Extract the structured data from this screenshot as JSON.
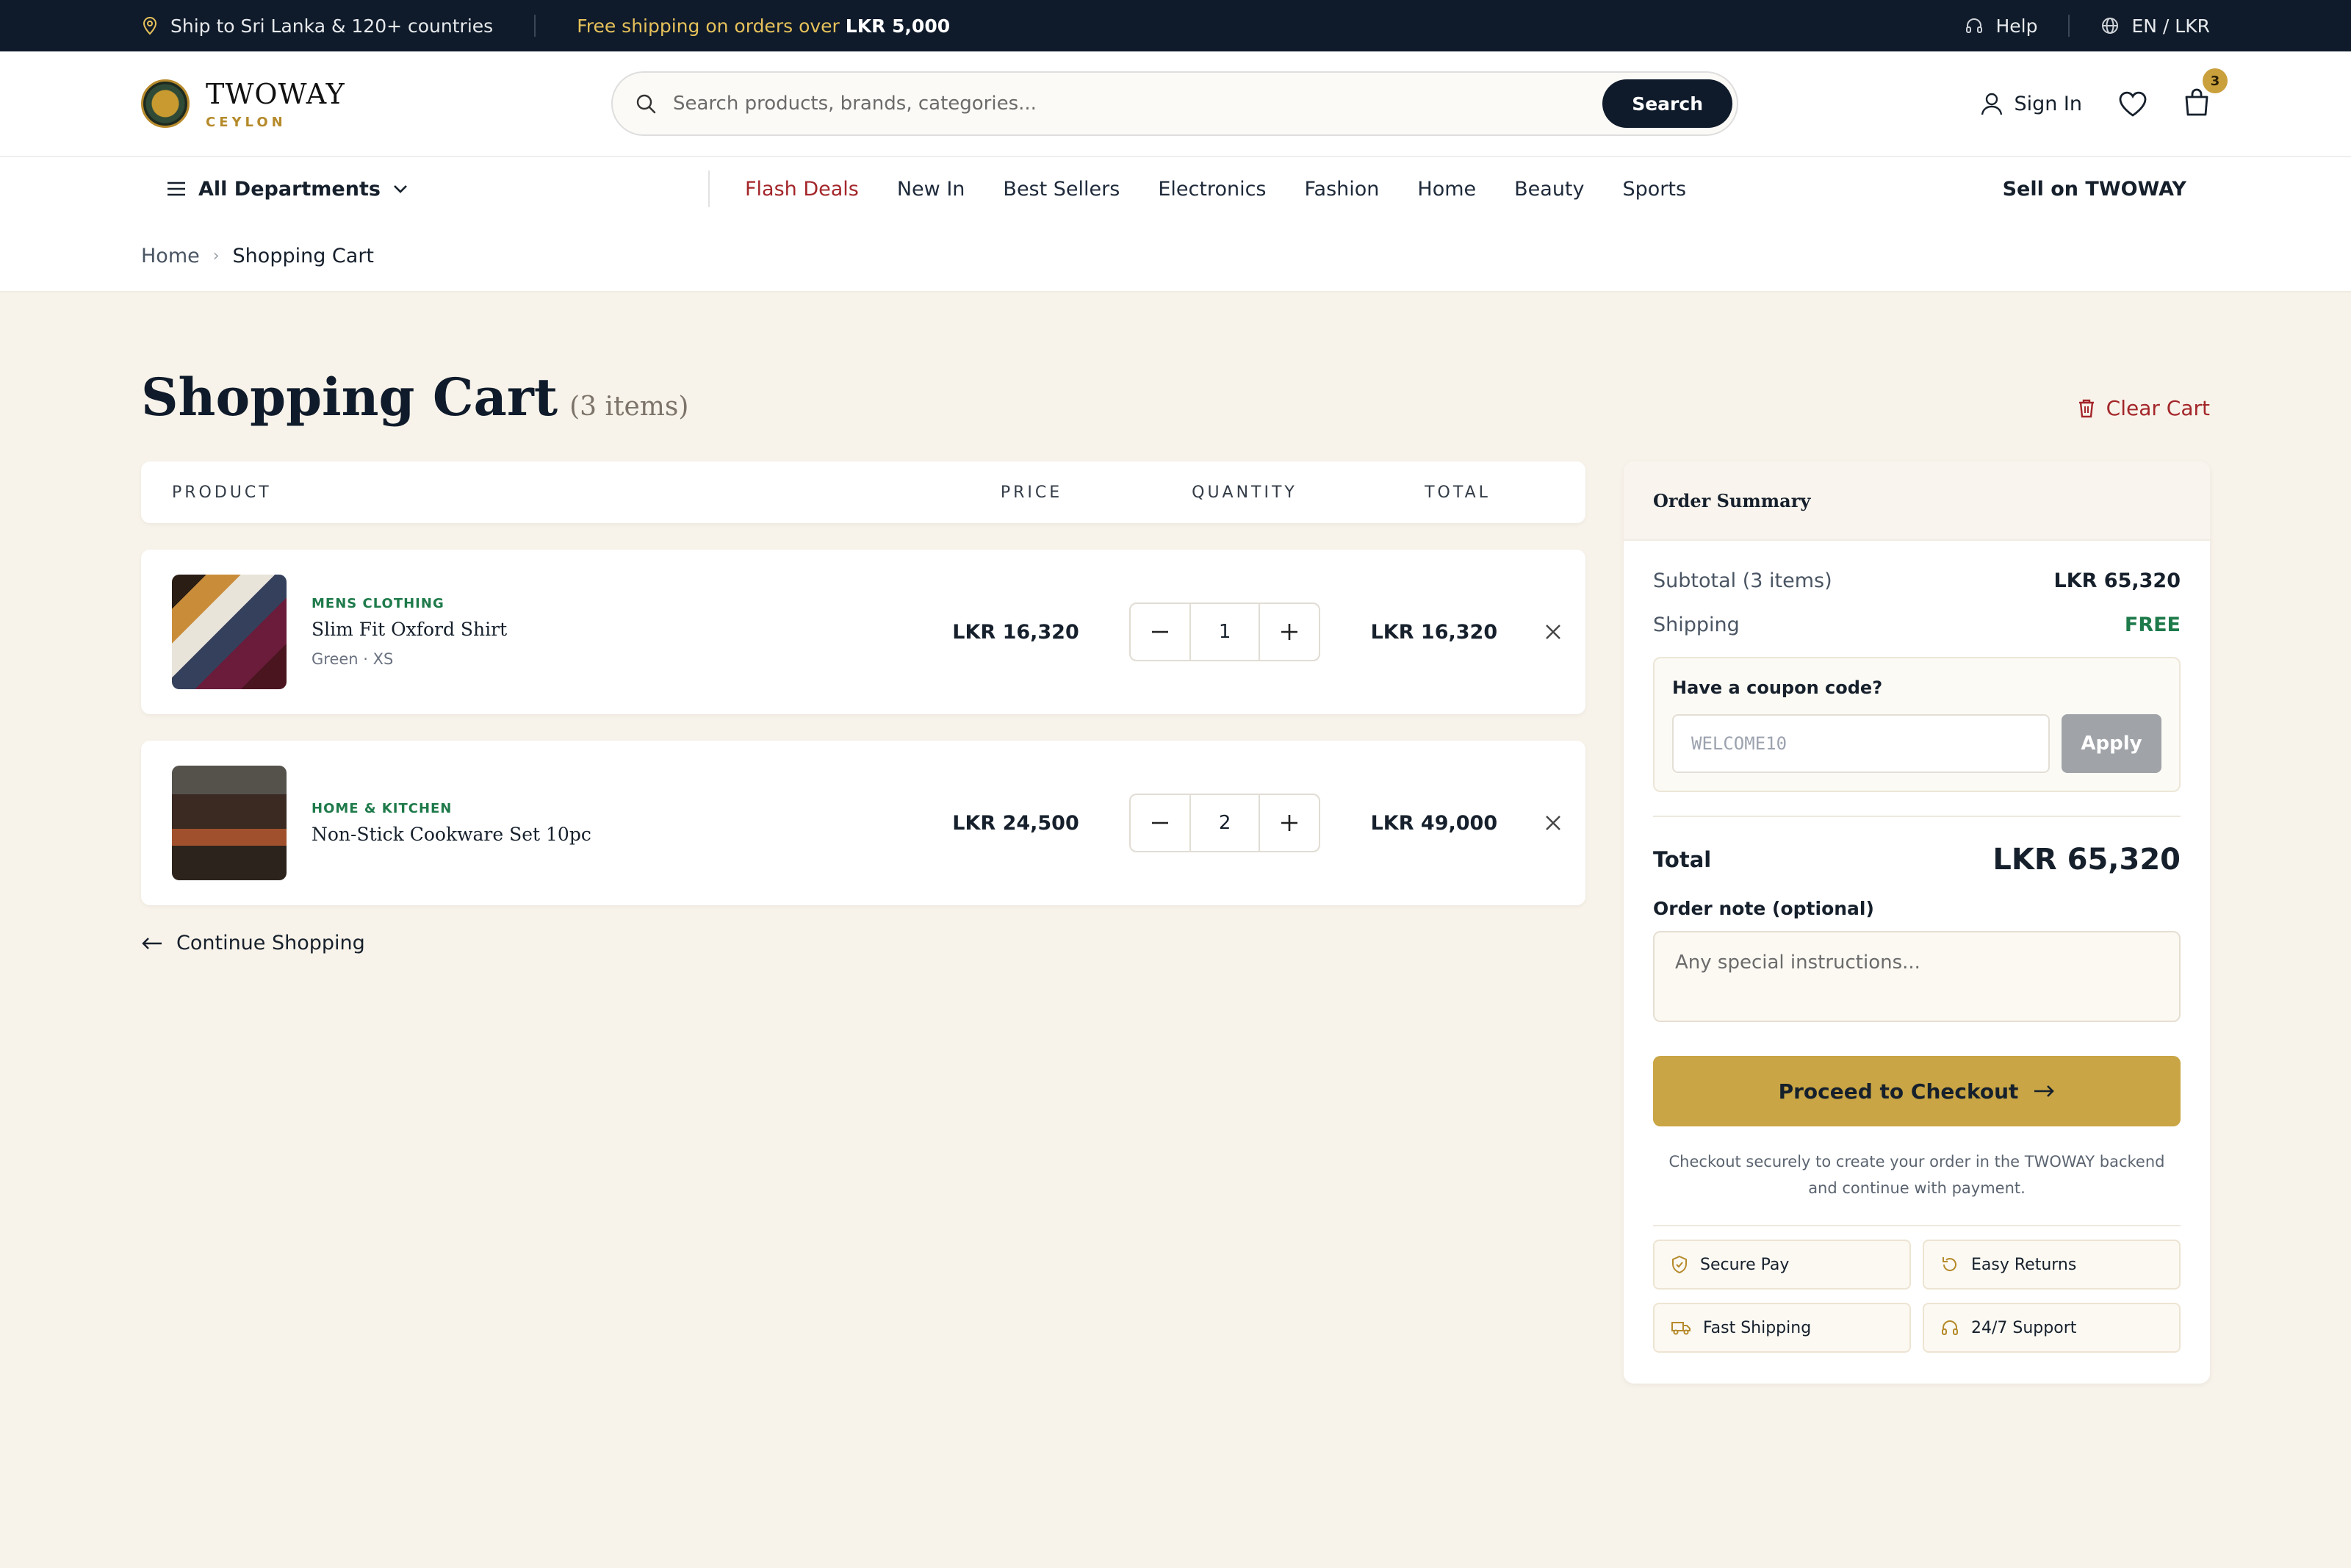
{
  "topbar": {
    "ship_text": "Ship to Sri Lanka & 120+ countries",
    "promo_prefix": "Free shipping on orders over",
    "promo_amount": "LKR 5,000",
    "help": "Help",
    "locale": "EN / LKR"
  },
  "header": {
    "brand": "TWOWAY",
    "brand_sub": "CEYLON",
    "search_placeholder": "Search products, brands, categories...",
    "search_button": "Search",
    "sign_in": "Sign In",
    "cart_count": "3"
  },
  "nav": {
    "departments": "All Departments",
    "links": [
      "Flash Deals",
      "New In",
      "Best Sellers",
      "Electronics",
      "Fashion",
      "Home",
      "Beauty",
      "Sports"
    ],
    "sell": "Sell on TWOWAY"
  },
  "breadcrumb": {
    "home": "Home",
    "current": "Shopping Cart"
  },
  "page": {
    "title": "Shopping Cart",
    "item_count": "(3 items)",
    "clear_cart": "Clear Cart"
  },
  "table": {
    "headers": {
      "product": "PRODUCT",
      "price": "PRICE",
      "quantity": "QUANTITY",
      "total": "TOTAL"
    }
  },
  "items": [
    {
      "category": "MENS CLOTHING",
      "name": "Slim Fit Oxford Shirt",
      "variant": "Green · XS",
      "price": "LKR 16,320",
      "quantity": "1",
      "total": "LKR 16,320"
    },
    {
      "category": "HOME & KITCHEN",
      "name": "Non-Stick Cookware Set 10pc",
      "variant": "",
      "price": "LKR 24,500",
      "quantity": "2",
      "total": "LKR 49,000"
    }
  ],
  "continue_shopping": "Continue Shopping",
  "summary": {
    "title": "Order Summary",
    "subtotal_label": "Subtotal (3 items)",
    "subtotal_value": "LKR 65,320",
    "shipping_label": "Shipping",
    "shipping_value": "FREE",
    "coupon_title": "Have a coupon code?",
    "coupon_placeholder": "WELCOME10",
    "apply": "Apply",
    "total_label": "Total",
    "total_value": "LKR 65,320",
    "note_label": "Order note (optional)",
    "note_placeholder": "Any special instructions...",
    "checkout": "Proceed to Checkout",
    "secure_note": "Checkout securely to create your order in the TWOWAY backend and continue with payment.",
    "badges": [
      "Secure Pay",
      "Easy Returns",
      "Fast Shipping",
      "24/7 Support"
    ]
  },
  "colors": {
    "navy": "#0f1b2b",
    "gold": "#c9a545",
    "accent_red": "#a3262a",
    "green": "#1e7a4a",
    "cream": "#f8f3ea"
  }
}
